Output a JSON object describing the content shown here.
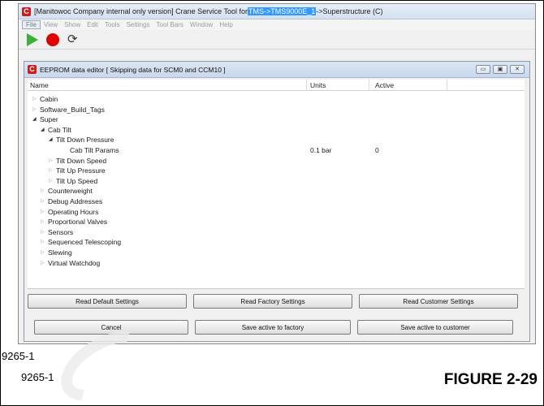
{
  "app": {
    "title_prefix": "[Manitowoc Company internal only  version] Crane Service Tool for ",
    "title_path": "TMS->TMS9000E_1",
    "title_suffix": "->Superstructure (C)",
    "logo": "C"
  },
  "menu": [
    "File",
    "View",
    "Show",
    "Edit",
    "Tools",
    "Settings",
    "Tool Bars",
    "Window",
    "Help"
  ],
  "toolbar": {
    "play_icon": "play-icon",
    "stop_icon": "stop-icon",
    "refresh_icon": "refresh-icon",
    "refresh_glyph": "⟳"
  },
  "editor": {
    "title": "EEPROM data editor [ Skipping data for SCM0 and CCM10 ]",
    "window_buttons": [
      "▭",
      "▣",
      "✕"
    ],
    "columns": {
      "name": "Name",
      "units": "Units",
      "active": "Active"
    },
    "rows": [
      {
        "label": "Cabin",
        "expanded": false,
        "units": "",
        "active": ""
      },
      {
        "label": "Software_Build_Tags",
        "expanded": false,
        "units": "",
        "active": ""
      },
      {
        "label": "Super",
        "expanded": true,
        "units": "",
        "active": ""
      },
      {
        "label": "Cab Tilt",
        "expanded": true,
        "units": "",
        "active": ""
      },
      {
        "label": "Tilt Down Pressure",
        "expanded": true,
        "units": "",
        "active": ""
      },
      {
        "label": "Cab Tilt Params",
        "expanded": null,
        "units": "0.1 bar",
        "active": "0"
      },
      {
        "label": "Tilt Down Speed",
        "expanded": false,
        "units": "",
        "active": ""
      },
      {
        "label": "Tilt Up Pressure",
        "expanded": false,
        "units": "",
        "active": ""
      },
      {
        "label": "Tilt Up Speed",
        "expanded": false,
        "units": "",
        "active": ""
      },
      {
        "label": "Counterweight",
        "expanded": false,
        "units": "",
        "active": ""
      },
      {
        "label": "Debug Addresses",
        "expanded": false,
        "units": "",
        "active": ""
      },
      {
        "label": "Operating Hours",
        "expanded": false,
        "units": "",
        "active": ""
      },
      {
        "label": "Proportional Valves",
        "expanded": false,
        "units": "",
        "active": ""
      },
      {
        "label": "Sensors",
        "expanded": false,
        "units": "",
        "active": ""
      },
      {
        "label": "Sequenced Telescoping",
        "expanded": false,
        "units": "",
        "active": ""
      },
      {
        "label": "Slewing",
        "expanded": false,
        "units": "",
        "active": ""
      },
      {
        "label": "Virtual Watchdog",
        "expanded": false,
        "units": "",
        "active": ""
      }
    ],
    "buttons_top": [
      "Read Default Settings",
      "Read Factory Settings",
      "Read Customer Settings"
    ],
    "buttons_bottom": [
      "Cancel",
      "Save active to factory",
      "Save active to customer"
    ]
  },
  "figure": {
    "code_small": "9265-1",
    "code": "9265-1",
    "label": "FIGURE 2-29"
  }
}
